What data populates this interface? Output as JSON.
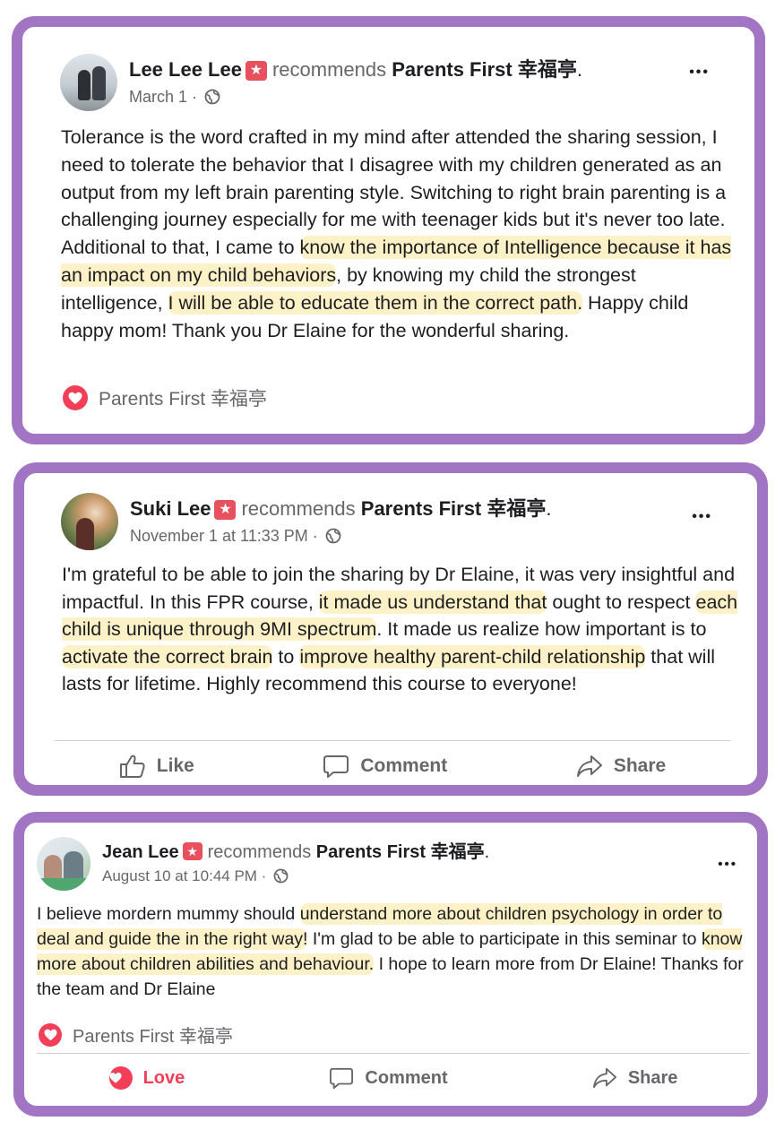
{
  "posts": [
    {
      "author": "Lee Lee Lee",
      "verb": "recommends",
      "page": "Parents First 幸福亭",
      "period": ".",
      "date": "March 1",
      "sep": " · ",
      "more": "•••",
      "body": [
        {
          "t": "Tolerance is the word crafted in my mind after attended the sharing session, I need to tolerate the behavior that I disagree with my children generated as an output from my left brain parenting style. Switching to right brain parenting is a challenging journey especially for me with teenager kids but it's never too late. Additional to that, I came to "
        },
        {
          "t": "know the importance of Intelligence because it has an impact on my child behaviors",
          "hl": true
        },
        {
          "t": ", by knowing my child the strongest intelligence, "
        },
        {
          "t": "I will be able to educate them in the correct path.",
          "hl": true
        },
        {
          "t": " Happy child happy mom! Thank you Dr Elaine for the wonderful sharing."
        }
      ],
      "reaction_label": "Parents First 幸福亭"
    },
    {
      "author": "Suki Lee",
      "verb": "recommends",
      "page": "Parents First 幸福亭",
      "period": ".",
      "date": "November 1 at 11:33 PM",
      "sep": " · ",
      "more": "•••",
      "body": [
        {
          "t": "I'm grateful to be able to join the sharing by Dr Elaine, it was very insightful and impactful. In this FPR course, "
        },
        {
          "t": "it made us understand that",
          "hl": true
        },
        {
          "t": " ought to respect "
        },
        {
          "t": "each child is unique through 9MI spectrum",
          "hl": true
        },
        {
          "t": ". It made us realize how important is to "
        },
        {
          "t": "activate the correct brain",
          "hl": true
        },
        {
          "t": " to "
        },
        {
          "t": "improve healthy parent-child relationship",
          "hl": true
        },
        {
          "t": " that will lasts for lifetime. Highly recommend this course to everyone!"
        }
      ],
      "actions": {
        "like": "Like",
        "comment": "Comment",
        "share": "Share"
      }
    },
    {
      "author": "Jean Lee",
      "verb": "recommends",
      "page": "Parents First 幸福亭",
      "period": ".",
      "date": "August 10 at 10:44 PM",
      "sep": " · ",
      "more": "•••",
      "body": [
        {
          "t": "I believe mordern mummy should "
        },
        {
          "t": "understand more about children psychology in order to deal and guide the in the right way!",
          "hl": true
        },
        {
          "t": " I'm glad to be able to participate in this seminar to "
        },
        {
          "t": "know more about children abilities and behaviour.",
          "hl": true
        },
        {
          "t": " I hope to learn more from Dr Elaine! Thanks for the team and Dr Elaine"
        }
      ],
      "reaction_label": "Parents First 幸福亭",
      "actions": {
        "love": "Love",
        "comment": "Comment",
        "share": "Share"
      }
    }
  ],
  "colors": {
    "frame": "#a274c4",
    "highlight": "#fdf1c7",
    "heart": "#f33e58",
    "badge": "#e8505e",
    "meta": "#65676b"
  },
  "icons": {
    "badge": "recommend-star-icon",
    "privacy": "globe-icon",
    "reaction": "love-heart-icon",
    "like": "thumbs-up-icon",
    "comment": "speech-bubble-icon",
    "share": "share-arrow-icon"
  }
}
